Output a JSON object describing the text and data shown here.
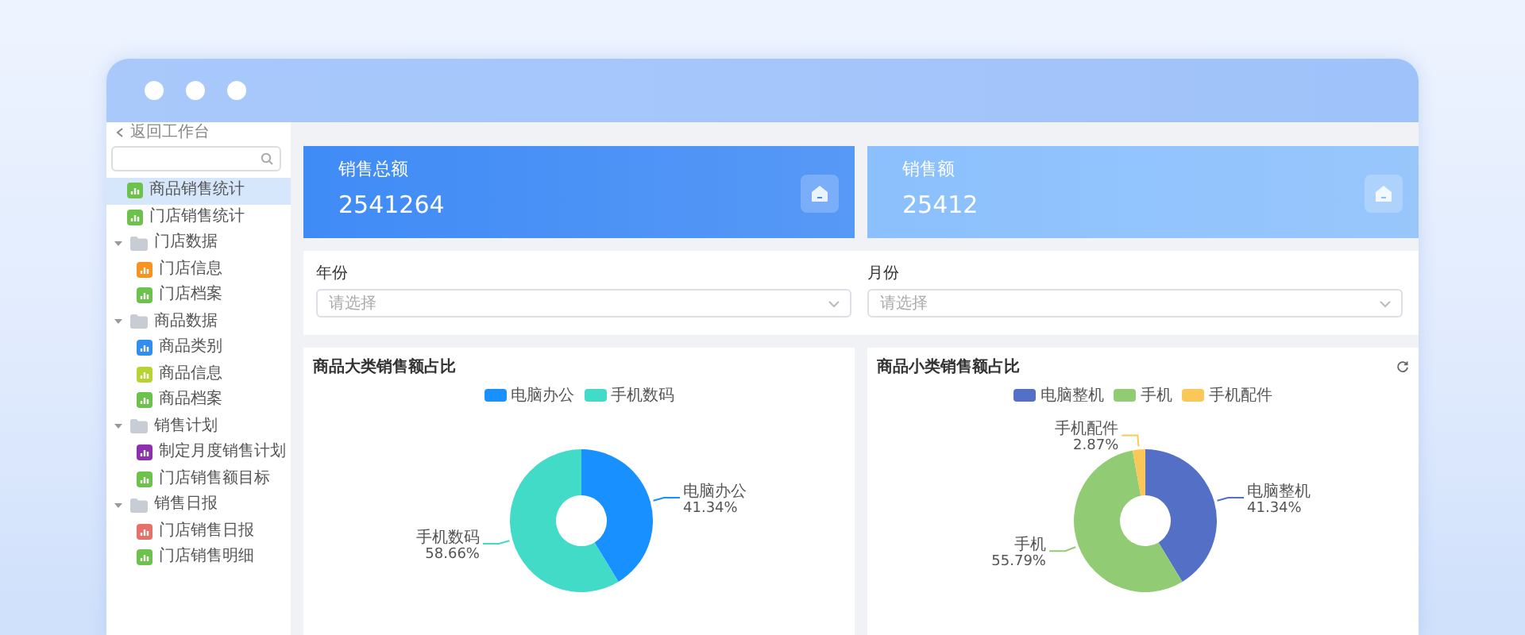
{
  "back_link": "返回工作台",
  "sidebar": {
    "items": [
      {
        "kind": "leaf",
        "label": "商品销售统计",
        "color": "#6cc24a",
        "selected": true
      },
      {
        "kind": "leaf",
        "label": "门店销售统计",
        "color": "#6cc24a",
        "selected": false
      },
      {
        "kind": "group",
        "label": "门店数据",
        "expanded": true,
        "selected": false,
        "children": [
          {
            "kind": "leaf",
            "label": "门店信息",
            "color": "#f7931e",
            "selected": false
          },
          {
            "kind": "leaf",
            "label": "门店档案",
            "color": "#6cc24a",
            "selected": false
          }
        ]
      },
      {
        "kind": "group",
        "label": "商品数据",
        "expanded": true,
        "selected": false,
        "children": [
          {
            "kind": "leaf",
            "label": "商品类别",
            "color": "#2f8ef0",
            "selected": false
          },
          {
            "kind": "leaf",
            "label": "商品信息",
            "color": "#b8d432",
            "selected": false
          },
          {
            "kind": "leaf",
            "label": "商品档案",
            "color": "#6cc24a",
            "selected": false
          }
        ]
      },
      {
        "kind": "group",
        "label": "销售计划",
        "expanded": true,
        "selected": false,
        "children": [
          {
            "kind": "leaf",
            "label": "制定月度销售计划",
            "color": "#8e2fb0",
            "selected": false
          },
          {
            "kind": "leaf",
            "label": "门店销售额目标",
            "color": "#6cc24a",
            "selected": false
          }
        ]
      },
      {
        "kind": "group",
        "label": "销售日报",
        "expanded": true,
        "selected": false,
        "children": [
          {
            "kind": "leaf",
            "label": "门店销售日报",
            "color": "#e8706a",
            "selected": false
          },
          {
            "kind": "leaf",
            "label": "门店销售明细",
            "color": "#6cc24a",
            "selected": false
          }
        ]
      }
    ]
  },
  "stats": [
    {
      "label": "销售总额",
      "value": "2541264",
      "color": "#3f8bf6"
    },
    {
      "label": "销售额",
      "value": "25412",
      "color": "#8bc0fd"
    }
  ],
  "filters": [
    {
      "label": "年份",
      "placeholder": "请选择"
    },
    {
      "label": "月份",
      "placeholder": "请选择"
    }
  ],
  "charts": [
    {
      "refreshable": false,
      "chart_data": {
        "type": "donut",
        "title": "商品大类销售额占比",
        "legend": "top",
        "categories": [
          "电脑办公",
          "手机数码"
        ],
        "values": [
          41.34,
          58.66
        ],
        "colors": [
          "#1890ff",
          "#42dbc7"
        ],
        "value_labels": [
          "41.34%",
          "58.66%"
        ]
      }
    },
    {
      "refreshable": true,
      "chart_data": {
        "type": "donut",
        "title": "商品小类销售额占比",
        "legend": "top",
        "categories": [
          "电脑整机",
          "手机",
          "手机配件"
        ],
        "values": [
          41.34,
          55.79,
          2.87
        ],
        "colors": [
          "#5470c6",
          "#91cc75",
          "#fac858"
        ],
        "value_labels": [
          "41.34%",
          "55.79%",
          "2.87%"
        ]
      }
    }
  ]
}
